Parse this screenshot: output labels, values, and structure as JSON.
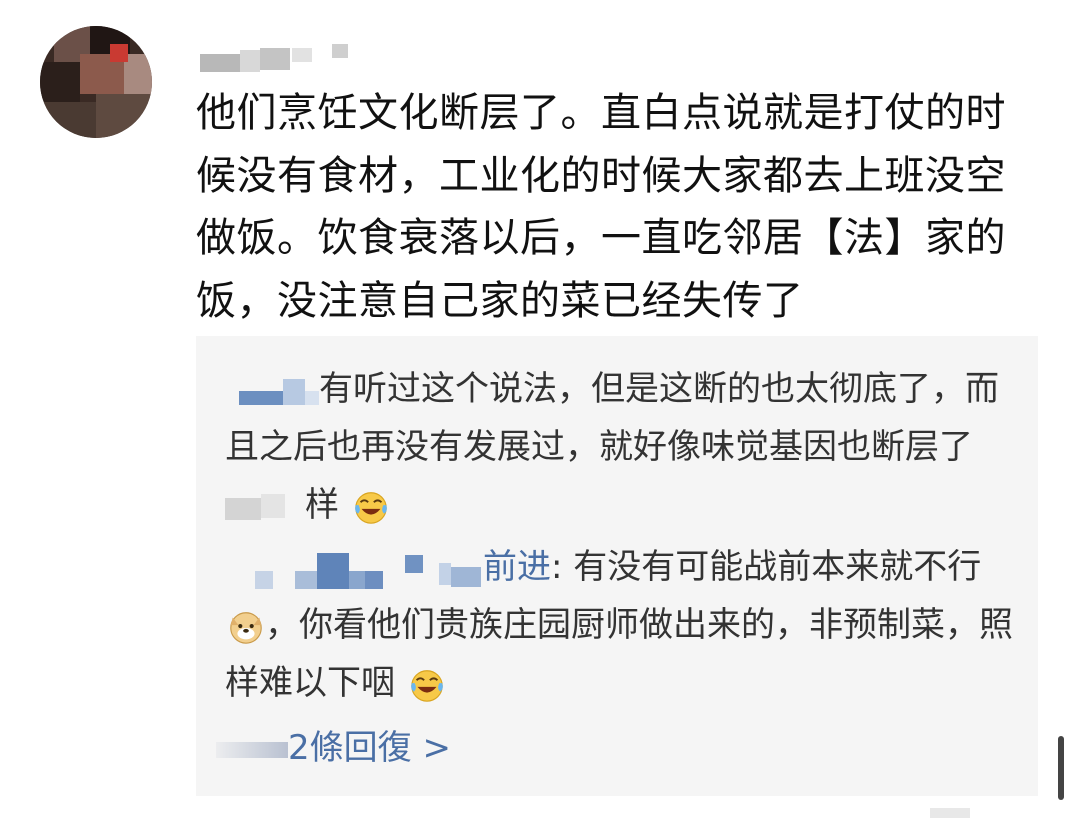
{
  "comment": {
    "avatar_icon": "avatar-icon",
    "text": "他们烹饪文化断层了。直白点说就是打仗的时候没有食材，工业化的时候大家都去上班没空做饭。饮食衰落以后，一直吃邻居【法】家的饭，没注意自己家的菜已经失传了"
  },
  "replies": [
    {
      "visible_text": "有听过这个说法，但是这断的也太彻底了，而且之后也再没有发展过，就好像味觉基因也断层了",
      "tail_text": "样",
      "emoji": "laugh-cry-emoji"
    },
    {
      "name_fragment": "前进",
      "text": ": 有没有可能战前本来就不行",
      "emoji_mid": "doge-emoji",
      "text_after": "，你看他们贵族庄园厨师做出来的，非预制菜，照样难以下咽",
      "emoji_end": "laugh-cry-emoji"
    }
  ],
  "more_replies": {
    "label": "2條回復 >"
  },
  "colors": {
    "link": "#4a6fa5",
    "panel_bg": "#f5f5f5"
  }
}
